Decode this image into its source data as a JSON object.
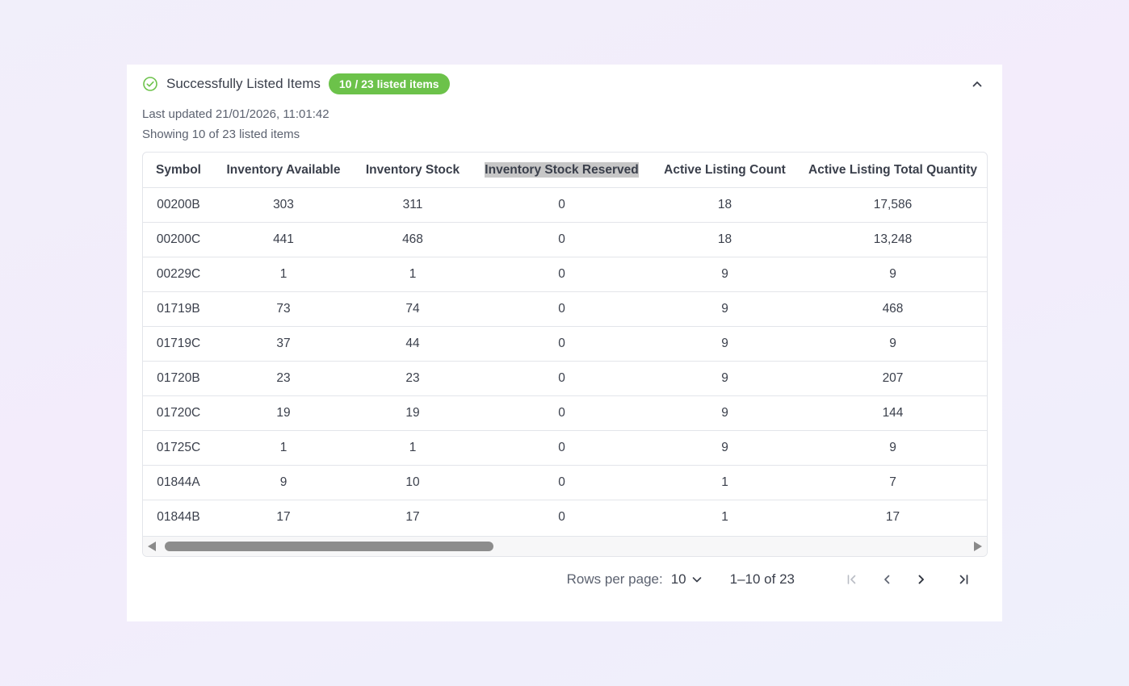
{
  "panel": {
    "title": "Successfully Listed Items",
    "badge": "10 / 23 listed items",
    "last_updated": "Last updated 21/01/2026, 11:01:42",
    "showing": "Showing 10 of 23 listed items"
  },
  "colors": {
    "accent_green": "#6cc24a",
    "highlight_gray": "#c7c7c7"
  },
  "icons": {
    "status": "check-circle-icon",
    "collapse": "chevron-up-icon",
    "rows_select": "chevron-down-icon",
    "first_page": "first-page-icon",
    "prev_page": "chevron-left-icon",
    "next_page": "chevron-right-icon",
    "last_page": "last-page-icon"
  },
  "table": {
    "columns": [
      "Symbol",
      "Inventory Available",
      "Inventory Stock",
      "Inventory Stock Reserved",
      "Active Listing Count",
      "Active Listing Total Quantity"
    ],
    "highlighted_column": "Inventory Stock Reserved",
    "rows": [
      [
        "00200B",
        "303",
        "311",
        "0",
        "18",
        "17,586"
      ],
      [
        "00200C",
        "441",
        "468",
        "0",
        "18",
        "13,248"
      ],
      [
        "00229C",
        "1",
        "1",
        "0",
        "9",
        "9"
      ],
      [
        "01719B",
        "73",
        "74",
        "0",
        "9",
        "468"
      ],
      [
        "01719C",
        "37",
        "44",
        "0",
        "9",
        "9"
      ],
      [
        "01720B",
        "23",
        "23",
        "0",
        "9",
        "207"
      ],
      [
        "01720C",
        "19",
        "19",
        "0",
        "9",
        "144"
      ],
      [
        "01725C",
        "1",
        "1",
        "0",
        "9",
        "9"
      ],
      [
        "01844A",
        "9",
        "10",
        "0",
        "1",
        "7"
      ],
      [
        "01844B",
        "17",
        "17",
        "0",
        "1",
        "17"
      ]
    ]
  },
  "pagination": {
    "rows_per_page_label": "Rows per page:",
    "rows_per_page_value": "10",
    "range": "1–10 of 23"
  }
}
